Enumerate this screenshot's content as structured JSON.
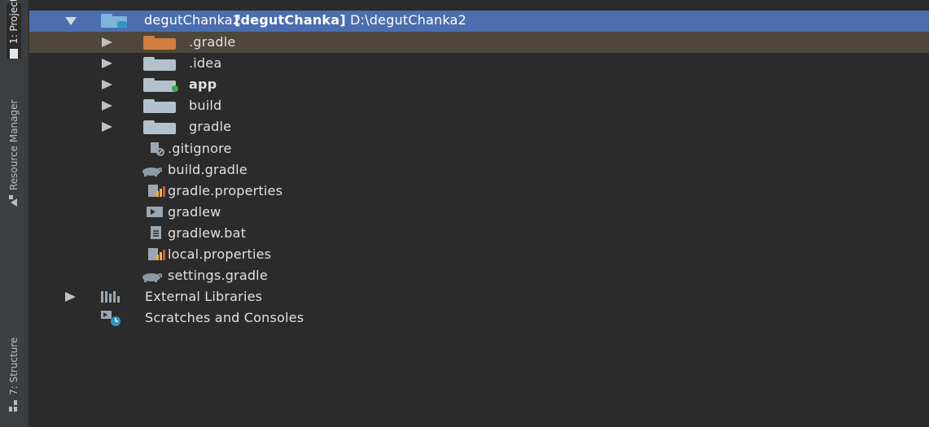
{
  "side_tabs": {
    "project": "1: Project",
    "resource_manager": "Resource Manager",
    "structure": "7: Structure"
  },
  "tree": {
    "root": {
      "name": "degutChanka2",
      "module": "[degutChanka]",
      "path": "D:\\degutChanka2"
    },
    "items": [
      {
        "label": ".gradle",
        "icon": "folder-orange-icon",
        "expandable": true
      },
      {
        "label": ".idea",
        "icon": "folder-icon",
        "expandable": true
      },
      {
        "label": "app",
        "icon": "module-folder-icon",
        "expandable": true
      },
      {
        "label": "build",
        "icon": "folder-icon",
        "expandable": true
      },
      {
        "label": "gradle",
        "icon": "folder-icon",
        "expandable": true
      },
      {
        "label": ".gitignore",
        "icon": "ignore-file-icon",
        "expandable": false
      },
      {
        "label": "build.gradle",
        "icon": "gradle-elephant-icon",
        "expandable": false
      },
      {
        "label": "gradle.properties",
        "icon": "properties-file-icon",
        "expandable": false
      },
      {
        "label": "gradlew",
        "icon": "shell-script-icon",
        "expandable": false
      },
      {
        "label": "gradlew.bat",
        "icon": "text-file-icon",
        "expandable": false
      },
      {
        "label": "local.properties",
        "icon": "properties-file-icon",
        "expandable": false
      },
      {
        "label": "settings.gradle",
        "icon": "gradle-elephant-icon",
        "expandable": false
      }
    ],
    "external_libraries": "External Libraries",
    "scratches": "Scratches and Consoles"
  },
  "colors": {
    "background": "#2b2b2b",
    "selection_root": "#4b6eaf",
    "selection_row": "#4f473b",
    "orange_folder": "#d37e3e"
  }
}
